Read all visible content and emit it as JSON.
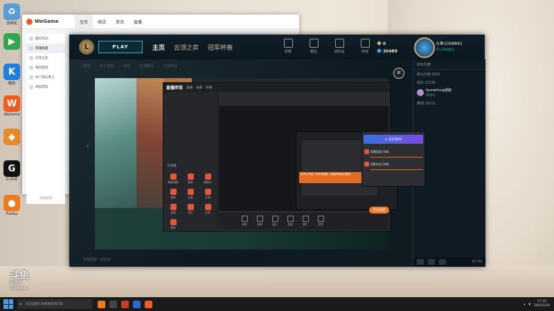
{
  "desktop": {
    "icons": [
      {
        "label": "回收站",
        "icon": "recycle-bin-icon",
        "color": "#5a9ad6",
        "glyph": "♻"
      },
      {
        "label": "",
        "icon": "play-icon",
        "color": "#2fa84f",
        "glyph": "▶"
      },
      {
        "label": "酷狗",
        "icon": "kugou-icon",
        "color": "#1e7fe0",
        "glyph": "K"
      },
      {
        "label": "WeGame",
        "icon": "wegame-icon",
        "color": "#f25a1f",
        "glyph": "W"
      },
      {
        "label": "",
        "icon": "game-app-icon",
        "color": "#e88a2a",
        "glyph": "◆"
      },
      {
        "label": "G HUB",
        "icon": "logitech-g-icon",
        "color": "#111111",
        "glyph": "G"
      },
      {
        "label": "Firefox",
        "icon": "firefox-icon",
        "color": "#f07a20",
        "glyph": "●"
      }
    ],
    "watermark": {
      "logo": "斗鱼",
      "sub": "直播号",
      "room": "1008841"
    }
  },
  "wegame": {
    "logo": "WeGame",
    "tabs": [
      "主页",
      "商店",
      "资讯",
      "直播"
    ],
    "sidebar": [
      "最近玩过",
      "英雄联盟",
      "云顶之弈",
      "我的游戏",
      "地下城与勇士",
      "添加游戏"
    ],
    "sidebar_footer": "添加游戏"
  },
  "lol": {
    "play_label": "PLAY",
    "nav": [
      "主页",
      "云顶之弈",
      "冠军杯赛"
    ],
    "subnav": [
      "概览",
      "补丁说明",
      "电竞",
      "云顶新闻",
      "商店新品"
    ],
    "icons": [
      {
        "label": "收藏",
        "icon": "collection-icon"
      },
      {
        "label": "藏品",
        "icon": "loot-icon"
      },
      {
        "label": "战利品",
        "icon": "chest-icon"
      },
      {
        "label": "商城",
        "icon": "store-icon"
      }
    ],
    "blue_essence": "0",
    "riot_points": "30489",
    "player_name": "斗鱼1008841",
    "player_status": "可以开始组队",
    "bottom_text": "英雄联盟 · 新版本",
    "social": {
      "header": "好友列表",
      "groups": [
        {
          "label": "默认分组 (0/3)"
        },
        {
          "label": "综合 (1/19)"
        }
      ],
      "friend": {
        "name": "Something很甜",
        "status": "游戏中"
      },
      "group3": "离线 (0/21)",
      "footer_time": "07:33"
    }
  },
  "streamer": {
    "title": "直播伴侣",
    "tabs": [
      "直播",
      "录像",
      "开播"
    ],
    "tools_label": "工具箱",
    "tools": [
      "美颜滤镜",
      "贴纸",
      "摄像头",
      "弹幕",
      "连麦",
      "礼物",
      "投票",
      "音乐",
      "分享",
      "更多"
    ],
    "bottom_buttons": [
      "场景",
      "屏幕",
      "窗口",
      "游戏",
      "图片",
      "音频"
    ],
    "live_label": "开始直播",
    "notice_text": "您可以开启一次本场直播，直播间地址已复制",
    "popup": {
      "banner": "★ 首页弹PK",
      "items": [
        "直播奖励已领取",
        "观看任务已完成"
      ]
    }
  },
  "taskbar": {
    "search_placeholder": "在这里输入你要搜索的内容",
    "time": "17:33",
    "date": "2025/1/24"
  }
}
